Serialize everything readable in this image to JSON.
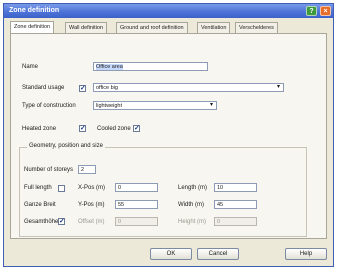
{
  "window": {
    "title": "Zone definition"
  },
  "tabs": [
    {
      "label": "Zone definition"
    },
    {
      "label": "Wall definition"
    },
    {
      "label": "Ground and roof definition"
    },
    {
      "label": "Ventilation"
    },
    {
      "label": "Verschelderes"
    }
  ],
  "form": {
    "name": {
      "label": "Name",
      "value": "Office area"
    },
    "standard_usage": {
      "label": "Standard usage",
      "checked": true,
      "value": "office big"
    },
    "construction": {
      "label": "Type of construction",
      "value": "lightweight"
    },
    "heated_zone": {
      "label": "Heated zone",
      "checked": true
    },
    "cooled_zone": {
      "label": "Cooled zone",
      "checked": true
    }
  },
  "geometry": {
    "title": "Geometry, position and size",
    "storeys": {
      "label": "Number of storeys",
      "value": "2"
    },
    "full_length": {
      "label": "Full length",
      "checked": false
    },
    "xpos": {
      "label": "X-Pos (m)",
      "value": "0"
    },
    "length": {
      "label": "Length (m)",
      "value": "10"
    },
    "ypos": {
      "label": "Y-Pos (m)",
      "value": "55"
    },
    "width": {
      "label": "Width (m)",
      "value": "45"
    },
    "offset": {
      "label": "Offset (m)",
      "value": "0"
    },
    "height": {
      "label": "Height (m)",
      "value": "0"
    },
    "left_labels": [
      "Ganze Breit",
      "Gesamthöhe"
    ]
  },
  "buttons": {
    "ok": "OK",
    "cancel": "Cancel",
    "help": "Help"
  },
  "icons": {
    "help": "?",
    "close": "×",
    "check": "✓",
    "combo": "▾"
  },
  "colors": {
    "title_bar": "#4f74d9",
    "check": "#1e3f8a"
  }
}
